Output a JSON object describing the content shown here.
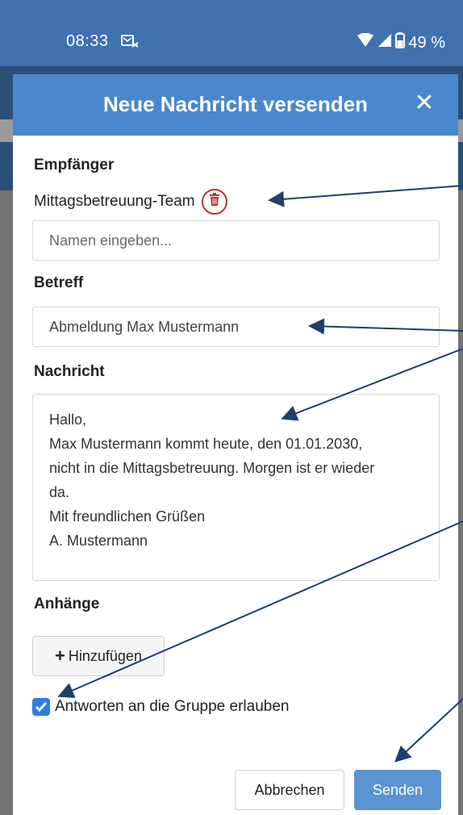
{
  "status_bar": {
    "time": "08:33",
    "battery": "49 %"
  },
  "modal": {
    "title": "Neue Nachricht versenden",
    "close_label": "✕"
  },
  "recipients": {
    "label": "Empfänger",
    "selected": "Mittagsbetreuung-Team",
    "input_placeholder": "Namen eingeben..."
  },
  "subject": {
    "label": "Betreff",
    "value": "Abmeldung Max Mustermann"
  },
  "message": {
    "label": "Nachricht",
    "lines": [
      "Hallo,",
      "Max Mustermann kommt heute, den 01.01.2030,",
      "nicht in die Mittagsbetreuung. Morgen ist er wieder",
      "da.",
      "Mit freundlichen Grüßen",
      "A. Mustermann"
    ]
  },
  "attachments": {
    "label": "Anhänge",
    "add_label": "Hinzufügen"
  },
  "reply_option": {
    "label": "Antworten an die Gruppe erlauben",
    "checked": true
  },
  "actions": {
    "cancel_label": "Abbrechen",
    "send_label": "Senden"
  },
  "colors": {
    "header": "#4a87cc",
    "status_bar": "#3f72ae",
    "accent": "#2f7de1",
    "delete": "#b03a32",
    "arrow": "#1f3f6b"
  }
}
